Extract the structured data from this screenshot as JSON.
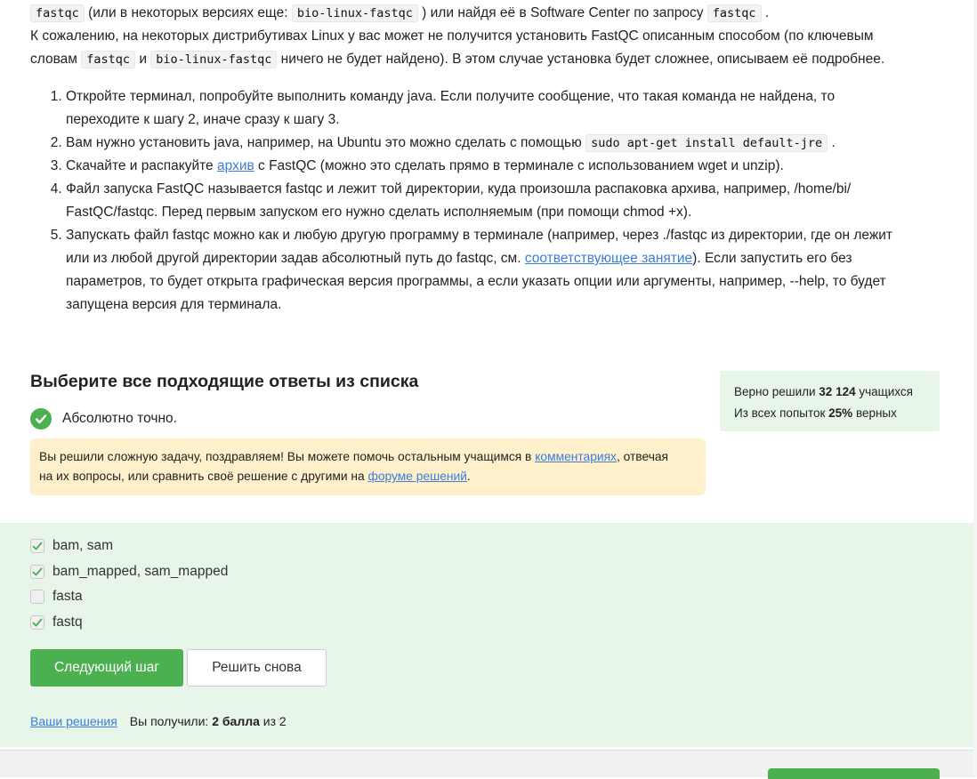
{
  "article": {
    "line1": {
      "code1": "fastqc",
      "t1": " (или в некоторых версиях еще: ",
      "code2": "bio-linux-fastqc",
      "t2": " ) или найдя её в Software Center по запросу ",
      "code3": "fastqc",
      "t3": " ."
    },
    "line2": "К сожалению, на некоторых дистрибутивах Linux у вас может не получится установить FastQC описанным способом (по ключевым",
    "line3": {
      "t1": "словам ",
      "code1": "fastqc",
      "t2": " и ",
      "code2": "bio-linux-fastqc",
      "t3": " ничего не будет найдено). В этом случае установка будет сложнее, описываем её подробнее."
    },
    "steps": [
      {
        "r1": "Откройте терминал, попробуйте выполнить команду java. Если получите сообщение, что такая команда не найдена, то",
        "r2": "переходите к шагу 2, иначе сразу к шагу 3."
      },
      {
        "t1": "Вам нужно установить java, например, на Ubuntu это можно сделать с помощью ",
        "code": "sudo apt-get install default-jre",
        "t2": " ."
      },
      {
        "t1": "Скачайте и распакуйте ",
        "link": "архив",
        "t2": " с FastQC (можно это сделать прямо в терминале с использованием wget и unzip)."
      },
      {
        "r1": "Файл запуска FastQC называется fastqc и лежит той директории, куда произошла распаковка архива, например, /home/bi/",
        "r2": "FastQC/fastqc. Перед первым запуском его нужно сделать исполняемым (при помощи chmod +x)."
      },
      {
        "r1": "Запускать файл fastqc можно как и любую другую программу в терминале (например, через ./fastqc из директории, где он лежит",
        "r2a": "или из любой другой директории задав абсолютный путь до fastqc, см. ",
        "r2link": "соответствующее занятие",
        "r2b": "). Если запустить его без",
        "r3": "параметров, то будет открыта графическая версия программы, а если указать опции или аргументы, например, --help, то будет",
        "r4": "запущена версия для терминала."
      }
    ]
  },
  "quiz": {
    "title": "Выберите все подходящие ответы из списка",
    "result": "Абсолютно точно.",
    "notice": {
      "t1": "Вы решили сложную задачу, поздравляем! Вы можете помочь остальным учащимся в ",
      "link1": "комментариях",
      "t2": ", отвечая",
      "t3": "на их вопросы, или сравнить своё решение с другими на ",
      "link2": "форуме решений",
      "t4": "."
    },
    "stats": {
      "solved_prefix": "Верно решили ",
      "solved_count": "32 124",
      "solved_suffix": " учащихся",
      "attempts_prefix": "Из всех попыток ",
      "attempts_pct": "25%",
      "attempts_suffix": " верных"
    },
    "options": [
      {
        "label": "bam, sam",
        "checked": true
      },
      {
        "label": "bam_mapped, sam_mapped",
        "checked": true
      },
      {
        "label": "fasta",
        "checked": false
      },
      {
        "label": "fastq",
        "checked": true
      }
    ],
    "next_button": "Следующий шаг",
    "retry_button": "Решить снова",
    "solutions_link": "Ваши решения",
    "score_prefix": "Вы получили: ",
    "score_value": "2 балла",
    "score_suffix": " из 2"
  },
  "colors": {
    "accent": "#4caf50",
    "link": "#3b7dd8",
    "notice_bg": "#fff0cc",
    "success_bg": "#e8f5e9"
  }
}
